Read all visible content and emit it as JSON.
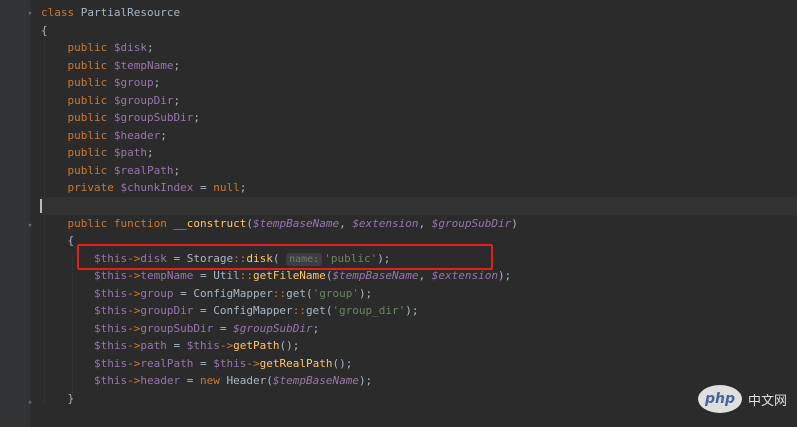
{
  "code_lines": [
    [
      {
        "t": "class",
        "c": "kw"
      },
      {
        "t": " PartialResource"
      }
    ],
    [
      {
        "t": "{"
      }
    ],
    [
      {
        "t": "    "
      },
      {
        "t": "public",
        "c": "kw"
      },
      {
        "t": " "
      },
      {
        "t": "$disk",
        "c": "var"
      },
      {
        "t": ";"
      }
    ],
    [
      {
        "t": "    "
      },
      {
        "t": "public",
        "c": "kw"
      },
      {
        "t": " "
      },
      {
        "t": "$tempName",
        "c": "var"
      },
      {
        "t": ";"
      }
    ],
    [
      {
        "t": "    "
      },
      {
        "t": "public",
        "c": "kw"
      },
      {
        "t": " "
      },
      {
        "t": "$group",
        "c": "var"
      },
      {
        "t": ";"
      }
    ],
    [
      {
        "t": "    "
      },
      {
        "t": "public",
        "c": "kw"
      },
      {
        "t": " "
      },
      {
        "t": "$groupDir",
        "c": "var"
      },
      {
        "t": ";"
      }
    ],
    [
      {
        "t": "    "
      },
      {
        "t": "public",
        "c": "kw"
      },
      {
        "t": " "
      },
      {
        "t": "$groupSubDir",
        "c": "var"
      },
      {
        "t": ";"
      }
    ],
    [
      {
        "t": "    "
      },
      {
        "t": "public",
        "c": "kw"
      },
      {
        "t": " "
      },
      {
        "t": "$header",
        "c": "var"
      },
      {
        "t": ";"
      }
    ],
    [
      {
        "t": "    "
      },
      {
        "t": "public",
        "c": "kw"
      },
      {
        "t": " "
      },
      {
        "t": "$path",
        "c": "var"
      },
      {
        "t": ";"
      }
    ],
    [
      {
        "t": "    "
      },
      {
        "t": "public",
        "c": "kw"
      },
      {
        "t": " "
      },
      {
        "t": "$realPath",
        "c": "var"
      },
      {
        "t": ";"
      }
    ],
    [
      {
        "t": "    "
      },
      {
        "t": "private",
        "c": "kw"
      },
      {
        "t": " "
      },
      {
        "t": "$chunkIndex",
        "c": "var"
      },
      {
        "t": " = ",
        "c": ""
      },
      {
        "t": "null",
        "c": "kw"
      },
      {
        "t": ";"
      }
    ],
    [
      {
        "t": ""
      }
    ],
    [
      {
        "t": "    "
      },
      {
        "t": "public",
        "c": "kw"
      },
      {
        "t": " "
      },
      {
        "t": "function",
        "c": "kw"
      },
      {
        "t": " "
      },
      {
        "t": "__construct",
        "c": "fn"
      },
      {
        "t": "("
      },
      {
        "t": "$tempBaseName",
        "c": "param"
      },
      {
        "t": ", "
      },
      {
        "t": "$extension",
        "c": "param"
      },
      {
        "t": ", "
      },
      {
        "t": "$groupSubDir",
        "c": "param"
      },
      {
        "t": ")"
      }
    ],
    [
      {
        "t": "    {"
      }
    ],
    [
      {
        "t": "        "
      },
      {
        "t": "$this",
        "c": "var"
      },
      {
        "t": "->",
        "c": "op"
      },
      {
        "t": "disk",
        "c": "var"
      },
      {
        "t": " = Storage"
      },
      {
        "t": "::",
        "c": "op"
      },
      {
        "t": "disk",
        "c": "fn"
      },
      {
        "t": "( "
      },
      {
        "t": "name:",
        "c": "hint"
      },
      {
        "t": "'public'",
        "c": "str"
      },
      {
        "t": ");"
      }
    ],
    [
      {
        "t": "        "
      },
      {
        "t": "$this",
        "c": "var"
      },
      {
        "t": "->",
        "c": "op"
      },
      {
        "t": "tempName",
        "c": "var"
      },
      {
        "t": " = Util"
      },
      {
        "t": "::",
        "c": "op"
      },
      {
        "t": "getFileName",
        "c": "fn"
      },
      {
        "t": "("
      },
      {
        "t": "$tempBaseName",
        "c": "param"
      },
      {
        "t": ", "
      },
      {
        "t": "$extension",
        "c": "param"
      },
      {
        "t": ");"
      }
    ],
    [
      {
        "t": "        "
      },
      {
        "t": "$this",
        "c": "var"
      },
      {
        "t": "->",
        "c": "op"
      },
      {
        "t": "group",
        "c": "var"
      },
      {
        "t": " = ConfigMapper"
      },
      {
        "t": "::",
        "c": "op"
      },
      {
        "t": "get"
      },
      {
        "t": "("
      },
      {
        "t": "'group'",
        "c": "str"
      },
      {
        "t": ");"
      }
    ],
    [
      {
        "t": "        "
      },
      {
        "t": "$this",
        "c": "var"
      },
      {
        "t": "->",
        "c": "op"
      },
      {
        "t": "groupDir",
        "c": "var"
      },
      {
        "t": " = ConfigMapper"
      },
      {
        "t": "::",
        "c": "op"
      },
      {
        "t": "get"
      },
      {
        "t": "("
      },
      {
        "t": "'group_dir'",
        "c": "str"
      },
      {
        "t": ");"
      }
    ],
    [
      {
        "t": "        "
      },
      {
        "t": "$this",
        "c": "var"
      },
      {
        "t": "->",
        "c": "op"
      },
      {
        "t": "groupSubDir",
        "c": "var"
      },
      {
        "t": " = "
      },
      {
        "t": "$groupSubDir",
        "c": "param"
      },
      {
        "t": ";"
      }
    ],
    [
      {
        "t": "        "
      },
      {
        "t": "$this",
        "c": "var"
      },
      {
        "t": "->",
        "c": "op"
      },
      {
        "t": "path",
        "c": "var"
      },
      {
        "t": " = "
      },
      {
        "t": "$this",
        "c": "var"
      },
      {
        "t": "->",
        "c": "op"
      },
      {
        "t": "getPath",
        "c": "fn"
      },
      {
        "t": "();"
      }
    ],
    [
      {
        "t": "        "
      },
      {
        "t": "$this",
        "c": "var"
      },
      {
        "t": "->",
        "c": "op"
      },
      {
        "t": "realPath",
        "c": "var"
      },
      {
        "t": " = "
      },
      {
        "t": "$this",
        "c": "var"
      },
      {
        "t": "->",
        "c": "op"
      },
      {
        "t": "getRealPath",
        "c": "fn"
      },
      {
        "t": "();"
      }
    ],
    [
      {
        "t": "        "
      },
      {
        "t": "$this",
        "c": "var"
      },
      {
        "t": "->",
        "c": "op"
      },
      {
        "t": "header",
        "c": "var"
      },
      {
        "t": " = "
      },
      {
        "t": "new",
        "c": "kw"
      },
      {
        "t": " Header("
      },
      {
        "t": "$tempBaseName",
        "c": "param"
      },
      {
        "t": ");"
      }
    ],
    [
      {
        "t": "    }"
      }
    ],
    [
      {
        "t": ""
      }
    ]
  ],
  "current_line_index": 11,
  "highlighted_line_index": 14,
  "watermark": {
    "logo_text": "php",
    "site_text": "中文网"
  },
  "colors": {
    "background": "#2b2b2b",
    "keyword": "#cc7832",
    "variable": "#9876aa",
    "function": "#ffc66d",
    "string": "#6a8759",
    "highlight_box": "#e0201b"
  }
}
